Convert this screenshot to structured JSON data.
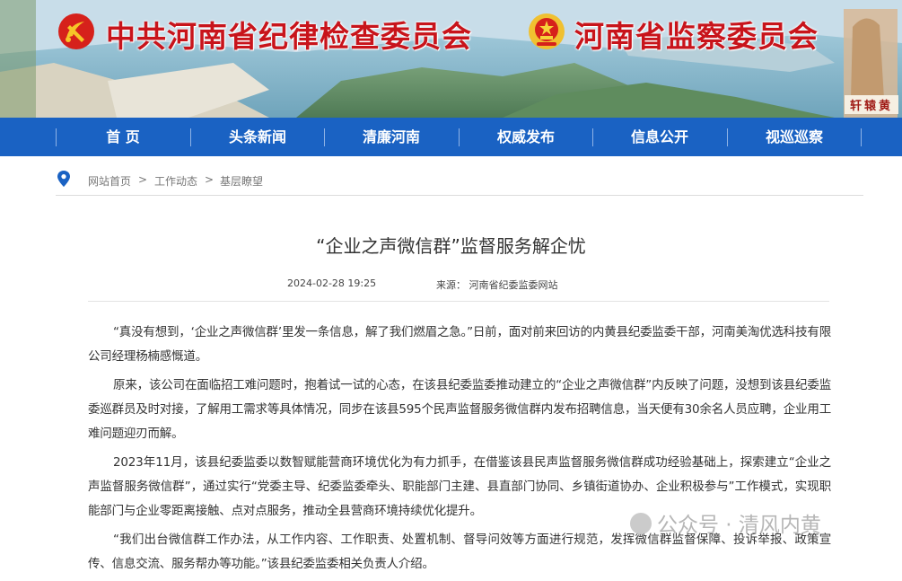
{
  "header": {
    "title_left": "中共河南省纪律检查委员会",
    "title_right": "河南省监察委员会",
    "corner_seal": "轩辕黄"
  },
  "nav": {
    "items": [
      "首 页",
      "头条新闻",
      "清廉河南",
      "权威发布",
      "信息公开",
      "视巡巡察"
    ]
  },
  "breadcrumb": {
    "home": "网站首页",
    "sep": ">",
    "level1": "工作动态",
    "level2": "基层瞭望"
  },
  "article": {
    "title": "“企业之声微信群”监督服务解企忧",
    "date": "2024-02-28 19:25",
    "source": "来源：  河南省纪委监委网站",
    "paragraphs": [
      "“真没有想到，‘企业之声微信群’里发一条信息，解了我们燃眉之急。”日前，面对前来回访的内黄县纪委监委干部，河南美淘优选科技有限公司经理杨楠感慨道。",
      "原来，该公司在面临招工难问题时，抱着试一试的心态，在该县纪委监委推动建立的“企业之声微信群”内反映了问题，没想到该县纪委监委巡群员及时对接，了解用工需求等具体情况，同步在该县595个民声监督服务微信群内发布招聘信息，当天便有30余名人员应聘，企业用工难问题迎刃而解。",
      "2023年11月，该县纪委监委以数智赋能营商环境优化为有力抓手，在借鉴该县民声监督服务微信群成功经验基础上，探索建立“企业之声监督服务微信群”，通过实行“党委主导、纪委监委牵头、职能部门主建、县直部门协同、乡镇街道协办、企业积极参与”工作模式，实现职能部门与企业零距离接触、点对点服务，推动全县营商环境持续优化提升。",
      "“我们出台微信群工作办法，从工作内容、工作职责、处置机制、督导问效等方面进行规范，发挥微信群监督保障、投诉举报、政策宣传、信息交流、服务帮办等功能。”该县纪委监委相关负责人介绍。"
    ]
  },
  "watermark": "公众号 · 清风内黄",
  "colors": {
    "nav_bg": "#1a62c3",
    "banner_title": "#c8141b",
    "body_text": "#333333"
  }
}
